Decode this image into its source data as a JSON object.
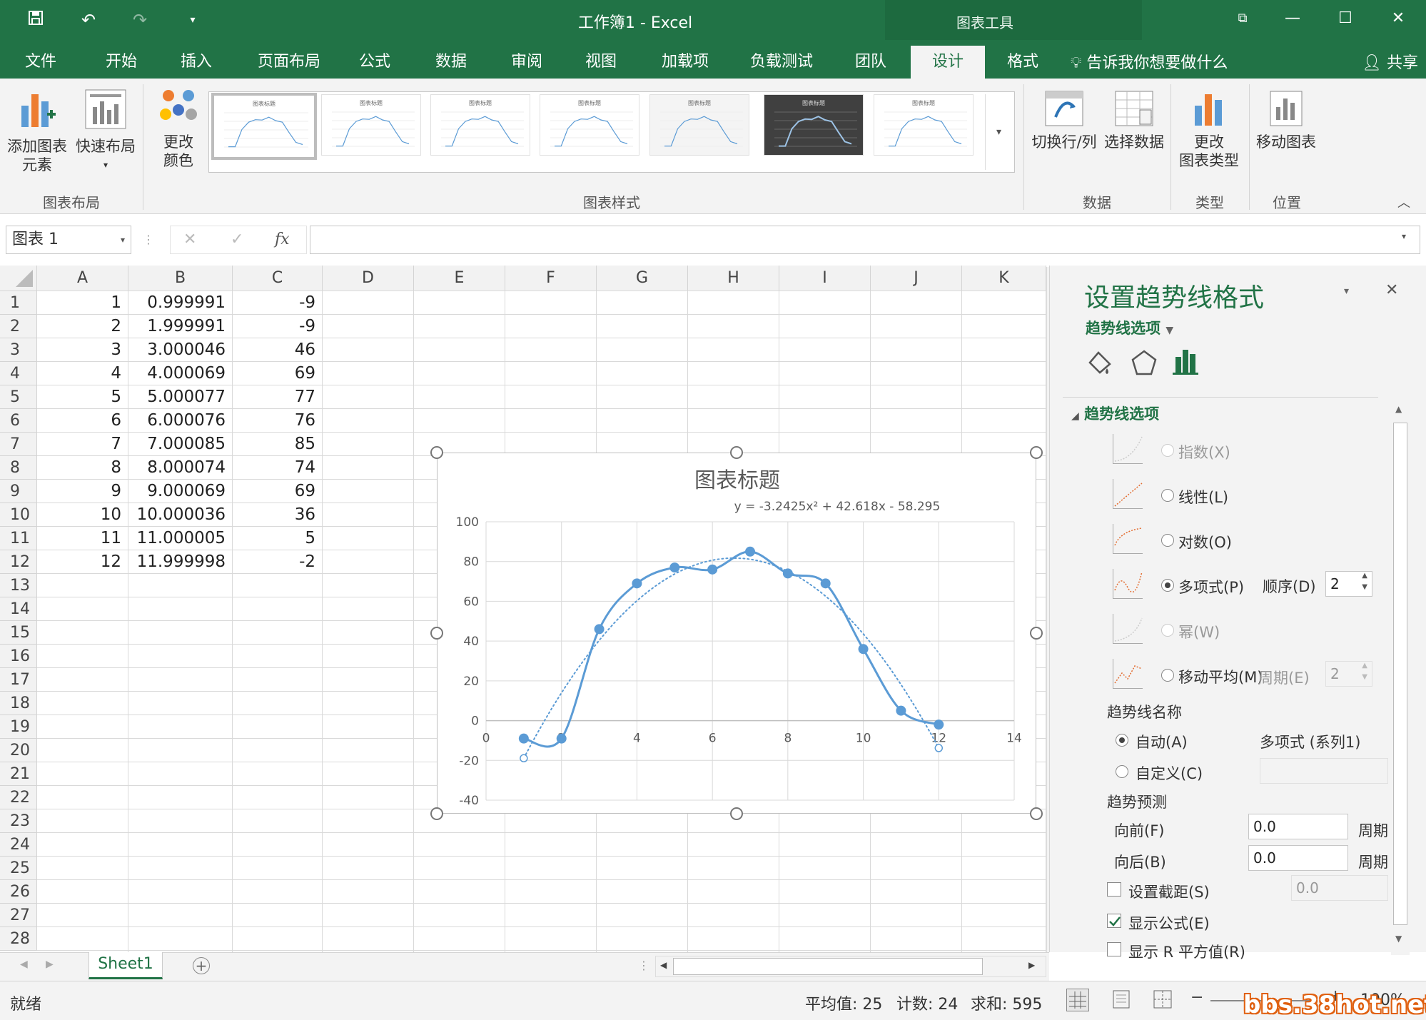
{
  "window": {
    "title": "工作簿1 - Excel",
    "context_title": "图表工具",
    "share_label": "共享"
  },
  "tabs": [
    "文件",
    "开始",
    "插入",
    "页面布局",
    "公式",
    "数据",
    "审阅",
    "视图",
    "加载项",
    "负载测试",
    "团队",
    "设计",
    "格式"
  ],
  "active_tab": "设计",
  "tell_me": "告诉我你想要做什么",
  "ribbon": {
    "add_element": "添加图表\n元素",
    "quick_layout": "快速布局",
    "change_color": "更改\n颜色",
    "group_layout": "图表布局",
    "group_styles": "图表样式",
    "switch_row_col": "切换行/列",
    "select_data": "选择数据",
    "group_data": "数据",
    "change_type": "更改\n图表类型",
    "group_type": "类型",
    "move_chart": "移动图表",
    "group_location": "位置",
    "style_thumb_title": "图表标题"
  },
  "formula_bar": {
    "name_box": "图表 1",
    "fx": "fx",
    "value": ""
  },
  "grid": {
    "columns": [
      "A",
      "B",
      "C",
      "D",
      "E",
      "F",
      "G",
      "H",
      "I",
      "J",
      "K"
    ],
    "rows": [
      "1",
      "2",
      "3",
      "4",
      "5",
      "6",
      "7",
      "8",
      "9",
      "10",
      "11",
      "12",
      "13",
      "14",
      "15",
      "16",
      "17",
      "18",
      "19",
      "20",
      "21",
      "22",
      "23",
      "24",
      "25",
      "26",
      "27",
      "28"
    ],
    "data": [
      [
        "1",
        "0.999991",
        "-9"
      ],
      [
        "2",
        "1.999991",
        "-9"
      ],
      [
        "3",
        "3.000046",
        "46"
      ],
      [
        "4",
        "4.000069",
        "69"
      ],
      [
        "5",
        "5.000077",
        "77"
      ],
      [
        "6",
        "6.000076",
        "76"
      ],
      [
        "7",
        "7.000085",
        "85"
      ],
      [
        "8",
        "8.000074",
        "74"
      ],
      [
        "9",
        "9.000069",
        "69"
      ],
      [
        "10",
        "10.000036",
        "36"
      ],
      [
        "11",
        "11.000005",
        "5"
      ],
      [
        "12",
        "11.999998",
        "-2"
      ]
    ]
  },
  "chart_data": {
    "type": "scatter",
    "title": "图表标题",
    "equation": "y = -3.2425x² + 42.618x - 58.295",
    "x_ticks": [
      "0",
      "2",
      "4",
      "6",
      "8",
      "10",
      "12",
      "14"
    ],
    "y_ticks": [
      "100",
      "80",
      "60",
      "40",
      "20",
      "0",
      "-20",
      "-40"
    ],
    "xlim": [
      0,
      14
    ],
    "ylim": [
      -40,
      100
    ],
    "grid": true,
    "line_style": "smooth",
    "series": [
      {
        "x": [
          0.999991,
          1.999991,
          3.000046,
          4.000069,
          5.000077,
          6.000076,
          7.000085,
          8.000074,
          9.000069,
          10.000036,
          11.000005,
          11.999998
        ],
        "y": [
          -9,
          -9,
          46,
          69,
          77,
          76,
          85,
          74,
          69,
          36,
          5,
          -2
        ]
      }
    ],
    "trendline": {
      "type": "polynomial",
      "order": 2,
      "coef": [
        -3.2425,
        42.618,
        -58.295
      ],
      "x_range": [
        1,
        12
      ],
      "style": "dotted"
    },
    "color": "#5b9bd5"
  },
  "pane": {
    "title": "设置趋势线格式",
    "options_menu": "趋势线选项",
    "section": "趋势线选项",
    "types": [
      {
        "label": "指数(X)",
        "selected": false,
        "dim": true
      },
      {
        "label": "线性(L)",
        "selected": false,
        "dim": false
      },
      {
        "label": "对数(O)",
        "selected": false,
        "dim": false
      },
      {
        "label": "多项式(P)",
        "selected": true,
        "dim": false
      },
      {
        "label": "幂(W)",
        "selected": false,
        "dim": true
      },
      {
        "label": "移动平均(M)",
        "selected": false,
        "dim": false
      }
    ],
    "order_label": "顺序(D)",
    "order_value": "2",
    "period_label": "周期(E)",
    "period_value": "2",
    "name_heading": "趋势线名称",
    "auto_label": "自动(A)",
    "auto_value": "多项式 (系列1)",
    "custom_label": "自定义(C)",
    "forecast_heading": "趋势预测",
    "forward_label": "向前(F)",
    "forward_value": "0.0",
    "backward_label": "向后(B)",
    "backward_value": "0.0",
    "period_unit": "周期",
    "intercept_label": "设置截距(S)",
    "intercept_value": "0.0",
    "show_equation_label": "显示公式(E)",
    "show_r2_label": "显示 R 平方值(R)"
  },
  "sheet_tab": "Sheet1",
  "status": {
    "ready": "就绪",
    "average": "平均值: 25",
    "count": "计数: 24",
    "sum": "求和: 595",
    "zoom": "100%"
  },
  "watermark": "bbs.38hot.net"
}
